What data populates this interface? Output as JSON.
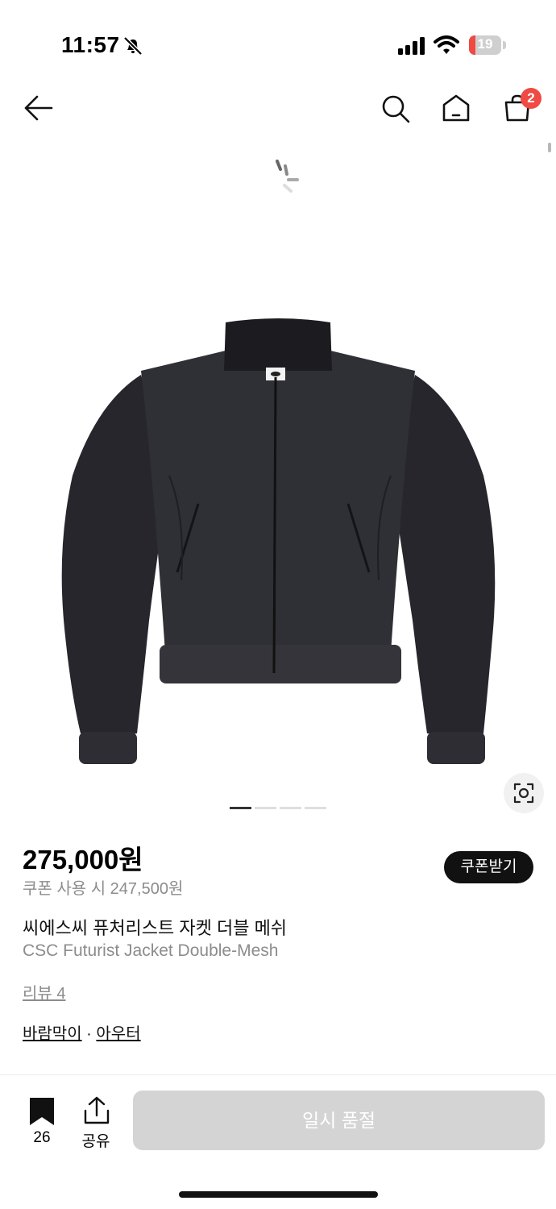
{
  "status_bar": {
    "time": "11:57",
    "battery_level": "19",
    "battery_fraction": 0.19
  },
  "nav": {
    "cart_count": "2"
  },
  "gallery": {
    "image_count": 4,
    "active_index": 0
  },
  "product": {
    "price": "275,000원",
    "coupon_price": "쿠폰 사용 시 247,500원",
    "coupon_button": "쿠폰받기",
    "name_ko": "씨에스씨 퓨처리스트 자켓 더블 메쉬",
    "name_en": "CSC Futurist Jacket Double-Mesh",
    "review": "리뷰 4",
    "categories": [
      "바람막이",
      "아우터"
    ],
    "category_sep": "·"
  },
  "bottom_bar": {
    "bookmark_count": "26",
    "share_label": "공유",
    "cta_label": "일시 품절"
  },
  "colors": {
    "badge": "#ef4a43",
    "cta_disabled": "#d4d4d4",
    "coupon_button_bg": "#111111"
  }
}
